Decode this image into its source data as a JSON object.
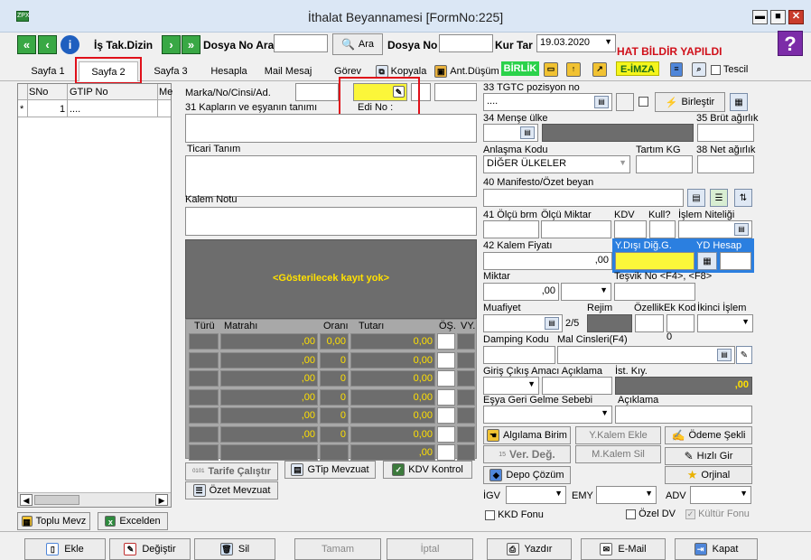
{
  "window": {
    "title": "İthalat Beyannamesi [FormNo:225]"
  },
  "toolbar": {
    "is_takip": "İş Tak.Dizin",
    "dosya_no_ara_label": "Dosya No Ara",
    "ara_button": "Ara",
    "dosya_no_label": "Dosya No",
    "kur_tar_label": "Kur Tar",
    "kur_tar_value": "19.03.2020",
    "hat_bildir": "HAT BİLDİR YAPILDI",
    "help": "?"
  },
  "tabs": [
    {
      "label": "Sayfa 1"
    },
    {
      "label": "Sayfa 2"
    },
    {
      "label": "Sayfa 3"
    },
    {
      "label": "Hesapla"
    },
    {
      "label": "Mail Mesaj"
    },
    {
      "label": "Görev"
    },
    {
      "label": "Kopyala"
    },
    {
      "label": "Ant.Düşüm"
    }
  ],
  "badges": {
    "birlik": "BİRLİK",
    "eimza": "E-İMZA",
    "tescil": "Tescil"
  },
  "grid": {
    "headers": [
      "SNo",
      "GTIP No",
      "Me"
    ],
    "row": {
      "marker": "*",
      "sno": "1",
      "gtip": "...."
    }
  },
  "left_buttons": {
    "toplu": "Toplu Mevz",
    "excel": "Excelden"
  },
  "middle": {
    "marka_label": "Marka/No/Cinsi/Ad.",
    "edi_label": "Edi No :",
    "kaplar_label": "31 Kapların ve eşyanın tanımı",
    "ticari_label": "Ticari Tanım",
    "kalem_notu_label": "Kalem Notu",
    "no_record": "<Gösterilecek kayıt yok>",
    "tax_headers": [
      "Türü",
      "Matrahı",
      "Oranı",
      "Tutarı",
      "ÖŞ.",
      "VY."
    ],
    "tax_rows": [
      {
        "matrah": ",00",
        "oran": "0,00",
        "tutar": "0,00"
      },
      {
        "matrah": ",00",
        "oran": "0",
        "tutar": "0,00"
      },
      {
        "matrah": ",00",
        "oran": "0",
        "tutar": "0,00"
      },
      {
        "matrah": ",00",
        "oran": "0",
        "tutar": "0,00"
      },
      {
        "matrah": ",00",
        "oran": "0",
        "tutar": "0,00"
      },
      {
        "matrah": ",00",
        "oran": "0",
        "tutar": "0,00"
      }
    ],
    "tax_last_tutar": ",00",
    "tarife_btn": "Tarife Çalıştır",
    "tarife_small": "0101",
    "gtip_btn": "GTip Mevzuat",
    "kdv_btn": "KDV Kontrol",
    "ozet_btn": "Özet Mevzuat"
  },
  "right": {
    "tgtc_label": "33 TGTC pozisyon no",
    "tgtc_value": "....",
    "birlestir": "Birleştir",
    "mense_label": "34 Menşe ülke",
    "brut_label": "35 Brüt ağırlık",
    "anlasma_label": "Anlaşma Kodu",
    "anlasma_value": "DİĞER ÜLKELER",
    "tartim_label": "Tartım KG",
    "net_label": "38 Net ağırlık",
    "manifesto_label": "40 Manifesto/Özet beyan",
    "olcu_brm": "41 Ölçü brm",
    "olcu_miktar": "Ölçü Miktar",
    "kdv": "KDV",
    "kull": "Kull?",
    "islem_niteligi": "İşlem Niteliği",
    "kalem_fiyati_label": "42 Kalem Fiyatı",
    "kalem_fiyati_value": ",00",
    "ydisi_label": "Y.Dışı Diğ.G.",
    "yd_hesap_label": "YD Hesap",
    "miktar_label": "Miktar",
    "miktar_value": ",00",
    "tesvik_label": "Teşvik No <F4>, <F8>",
    "muafiyet_label": "Muafiyet",
    "muafiyet_count": "2/5",
    "rejim_label": "Rejim",
    "ozellik_label": "Özellik",
    "ek_kod_label": "Ek Kod",
    "ikinci_islem_label": "İkinci İşlem",
    "damping_label": "Damping Kodu",
    "mal_cinsleri_label": "Mal Cinsleri(F4)",
    "damping_zero": "0",
    "giris_label": "Giriş Çıkış Amacı Açıklama",
    "ist_kiy_label": "İst. Kıy.",
    "ist_kiy_value": ",00",
    "esya_label": "Eşya Geri Gelme Sebebi",
    "aciklama_label": "Açıklama",
    "btn_algilama": "Algılama Birim",
    "btn_ykalem": "Y.Kalem Ekle",
    "btn_odeme": "Ödeme Şekli",
    "btn_verdeg": "Ver. Değ.",
    "btn_verdeg_small": "15",
    "btn_mkalem": "M.Kalem Sil",
    "btn_hizli": "Hızlı Gir",
    "btn_depo": "Depo Çözüm",
    "btn_orjinal": "Orjinal",
    "igv_label": "İGV",
    "emy_label": "EMY",
    "adv_label": "ADV",
    "kkd_label": "KKD Fonu",
    "ozel_dv_label": "Özel DV",
    "kultur_label": "Kültür Fonu"
  },
  "bottom": {
    "ekle": "Ekle",
    "degistir": "Değiştir",
    "sil": "Sil",
    "tamam": "Tamam",
    "iptal": "İptal",
    "yazdir": "Yazdır",
    "email": "E-Mail",
    "kapat": "Kapat"
  }
}
